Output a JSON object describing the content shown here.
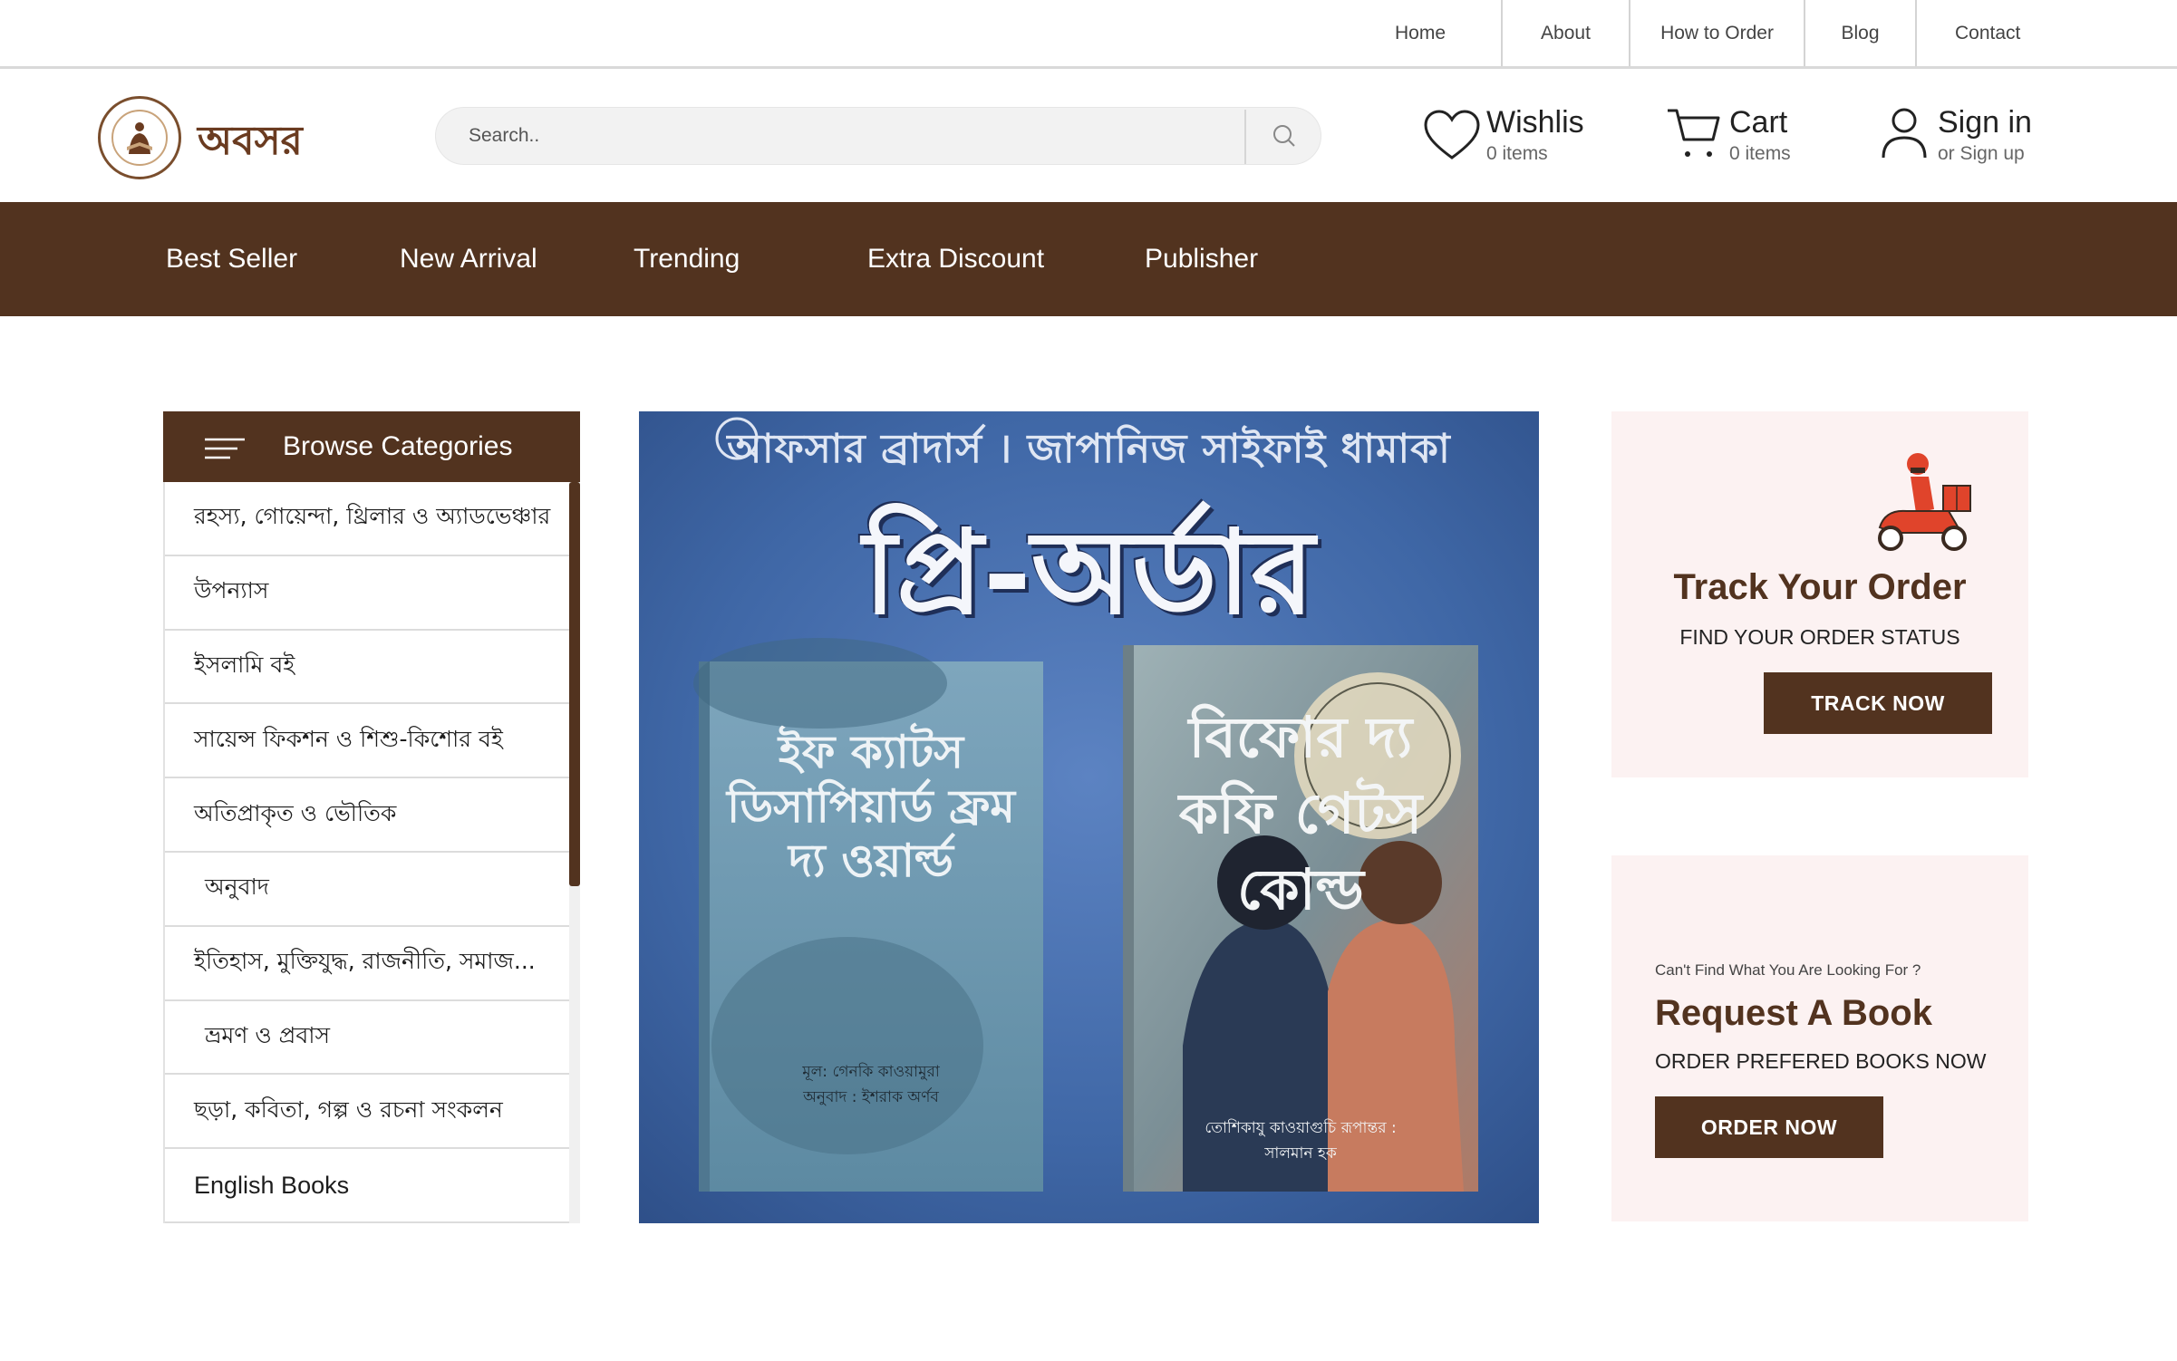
{
  "topnav": {
    "links": [
      "Home",
      "About",
      "How to Order",
      "Blog",
      "Contact"
    ]
  },
  "brand": {
    "name": "অবসর",
    "logo_icon": "reading-person-seal-icon"
  },
  "search": {
    "placeholder": "Search..",
    "icon": "search-icon"
  },
  "header": {
    "wishlist": {
      "title": "Wishlis",
      "sub": "0 items",
      "icon": "heart-icon"
    },
    "cart": {
      "title": "Cart",
      "sub": "0 items",
      "icon": "cart-icon"
    },
    "account": {
      "title": "Sign in",
      "sub": "or Sign up",
      "icon": "user-icon"
    }
  },
  "catbar": {
    "items": [
      "Best Seller",
      "New Arrival",
      "Trending",
      "Extra Discount",
      "Publisher"
    ]
  },
  "sidebar": {
    "title": "Browse Categories",
    "icon": "hamburger-icon",
    "items": [
      "রহস্য, গোয়েন্দা, থ্রিলার ও অ্যাডভেঞ্চার",
      "উপন্যাস",
      "ইসলামি বই",
      "সায়েন্স ফিকশন ও শিশু-কিশোর বই",
      "অতিপ্রাকৃত ও ভৌতিক",
      "অনুবাদ",
      "ইতিহাস, মুক্তিযুদ্ধ, রাজনীতি, সমাজ...",
      "ভ্রমণ ও প্রবাস",
      "ছড়া, কবিতা, গল্প ও রচনা সংকলন",
      "English Books"
    ]
  },
  "banner": {
    "top_line": "আফসার ব্রাদার্স । জাপানিজ সাইফাই ধামাকা",
    "headline": "প্রি-অর্ডার",
    "book1": {
      "title": "ইফ ক্যাটস ডিসাপিয়ার্ড ফ্রম দ্য ওয়ার্ল্ড",
      "authors": "মূল: গেনকি কাওয়ামুরা অনুবাদ : ইশরাক অর্ণব"
    },
    "book2": {
      "title": "বিফোর দ্য কফি গেটস কোল্ড",
      "authors": "তোশিকাযু কাওয়াগুচি রূপান্তর : সালমান হক"
    },
    "colors": {
      "background": "#3f67a6",
      "book1": "#6b95ad",
      "book2": "#c98a6e"
    }
  },
  "track": {
    "icon": "delivery-scooter-icon",
    "title": "Track Your Order",
    "sub": "FIND YOUR ORDER STATUS",
    "button": "TRACK NOW"
  },
  "request": {
    "small": "Can't Find What You Are Looking For ?",
    "title": "Request A Book",
    "sub": "ORDER PREFERED BOOKS NOW",
    "button": "ORDER NOW"
  },
  "colors": {
    "brand_brown": "#52331f",
    "card_bg": "#fcf2f2"
  }
}
